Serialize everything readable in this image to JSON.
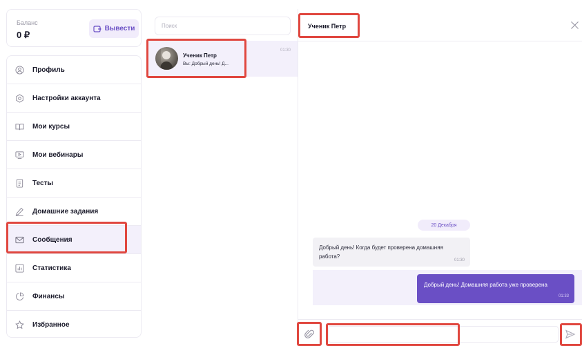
{
  "balance": {
    "label": "Баланс",
    "value": "0 ₽",
    "withdraw_label": "Вывести"
  },
  "sidebar": {
    "items": [
      {
        "label": "Профиль",
        "icon": "user-circle-icon"
      },
      {
        "label": "Настройки аккаунта",
        "icon": "settings-icon"
      },
      {
        "label": "Мои курсы",
        "icon": "book-icon"
      },
      {
        "label": "Мои вебинары",
        "icon": "webinar-icon"
      },
      {
        "label": "Тесты",
        "icon": "document-icon"
      },
      {
        "label": "Домашние задания",
        "icon": "pencil-icon"
      },
      {
        "label": "Сообщения",
        "icon": "envelope-icon",
        "active": true
      },
      {
        "label": "Статистика",
        "icon": "chart-icon"
      },
      {
        "label": "Финансы",
        "icon": "pie-chart-icon"
      },
      {
        "label": "Избранное",
        "icon": "star-icon"
      }
    ]
  },
  "chat_list": {
    "search_placeholder": "Поиск",
    "items": [
      {
        "name": "Ученик Петр",
        "preview": "Вы: Добрый день! Д...",
        "time": "01:30"
      }
    ]
  },
  "conversation": {
    "title": "Ученик Петр",
    "date_label": "20 Декабря",
    "messages": [
      {
        "direction": "in",
        "text": "Добрый день! Когда будет проверена домашняя работа?",
        "time": "01:30"
      },
      {
        "direction": "out",
        "text": "Добрый день! Домашняя работа уже проверена",
        "time": "01:33"
      }
    ],
    "input_value": ""
  },
  "colors": {
    "accent": "#6a4fc5",
    "accent_light": "#f3f0fb",
    "highlight": "#e0473f"
  }
}
